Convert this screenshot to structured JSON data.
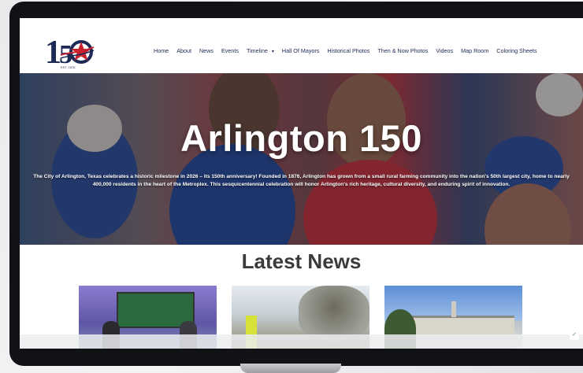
{
  "site": {
    "logo_text": "150",
    "logo_subtext": "EST. 1876"
  },
  "nav": {
    "items": [
      "Home",
      "About",
      "News",
      "Events",
      "Timeline",
      "Hall Of Mayors",
      "Historical Photos",
      "Then & Now Photos",
      "Videos",
      "Map Room",
      "Coloring Sheets"
    ],
    "timeline_caret": "▾"
  },
  "hero": {
    "title": "Arlington 150",
    "text": "The City of Arlington, Texas celebrates a historic milestone in 2026 – its 150th anniversary! Founded in 1876, Arlington has grown from a small rural farming community into the nation's 50th largest city, home to nearly 400,000 residents in the heart of the Metroplex. This sesquicentennial celebration will honor Arlington's rich heritage, cultural diversity, and enduring spirit of innovation."
  },
  "news": {
    "heading": "Latest News"
  },
  "colors": {
    "navy": "#1d2a55",
    "red": "#c8222f",
    "heading": "#3a3a3a"
  },
  "icons": {
    "recaptcha": "recaptcha-icon"
  }
}
